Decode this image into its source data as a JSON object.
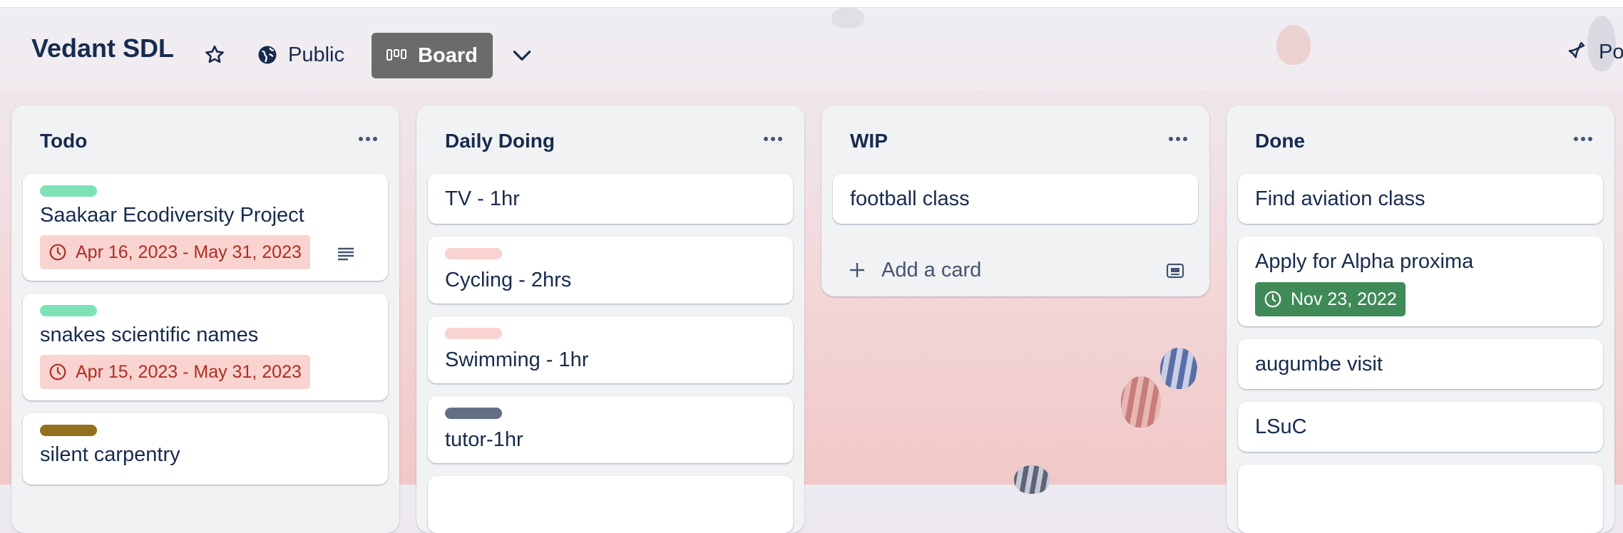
{
  "board": {
    "title": "Vedant SDL",
    "visibility_label": "Public",
    "view_label": "Board",
    "power_ups_label": "Po"
  },
  "icons": {
    "star": "star-icon",
    "visibility": "globe-icon",
    "view": "board-icon",
    "view_switch": "chevron-down-icon",
    "power_ups": "rocket-icon",
    "list_menu": "more-horizontal-icon",
    "due": "clock-icon",
    "description": "description-icon",
    "add": "plus-icon",
    "template": "card-template-icon"
  },
  "colors": {
    "label_green": "#7ee2b8",
    "label_red": "#f8d3cf",
    "label_olive": "#946f1f",
    "label_slate": "#626f86",
    "overdue_bg": "#f9d3cf",
    "complete_bg": "#3f8a57",
    "view_button_bg": "#6b6b6b"
  },
  "lists": [
    {
      "title": "Todo",
      "cards": [
        {
          "title": "Saakaar Ecodiversity Project",
          "label_color": "#7ee2b8",
          "due": "Apr 16, 2023 - May 31, 2023",
          "due_status": "overdue",
          "has_description": true
        },
        {
          "title": "snakes scientific names",
          "label_color": "#7ee2b8",
          "due": "Apr 15, 2023 - May 31, 2023",
          "due_status": "overdue"
        },
        {
          "title": "silent carpentry",
          "label_color": "#946f1f"
        }
      ]
    },
    {
      "title": "Daily Doing",
      "cards": [
        {
          "title": "TV - 1hr"
        },
        {
          "title": "Cycling - 2hrs",
          "label_color": "#f8d3cf"
        },
        {
          "title": "Swimming - 1hr",
          "label_color": "#f8d3cf"
        },
        {
          "title": "tutor-1hr",
          "label_color": "#626f86"
        }
      ]
    },
    {
      "title": "WIP",
      "cards": [
        {
          "title": "football class"
        }
      ],
      "add_card_label": "Add a card"
    },
    {
      "title": "Done",
      "cards": [
        {
          "title": "Find aviation class"
        },
        {
          "title": "Apply for Alpha proxima",
          "due": "Nov 23, 2022",
          "due_status": "complete"
        },
        {
          "title": "augumbe visit"
        },
        {
          "title": "LSuC"
        }
      ]
    }
  ]
}
